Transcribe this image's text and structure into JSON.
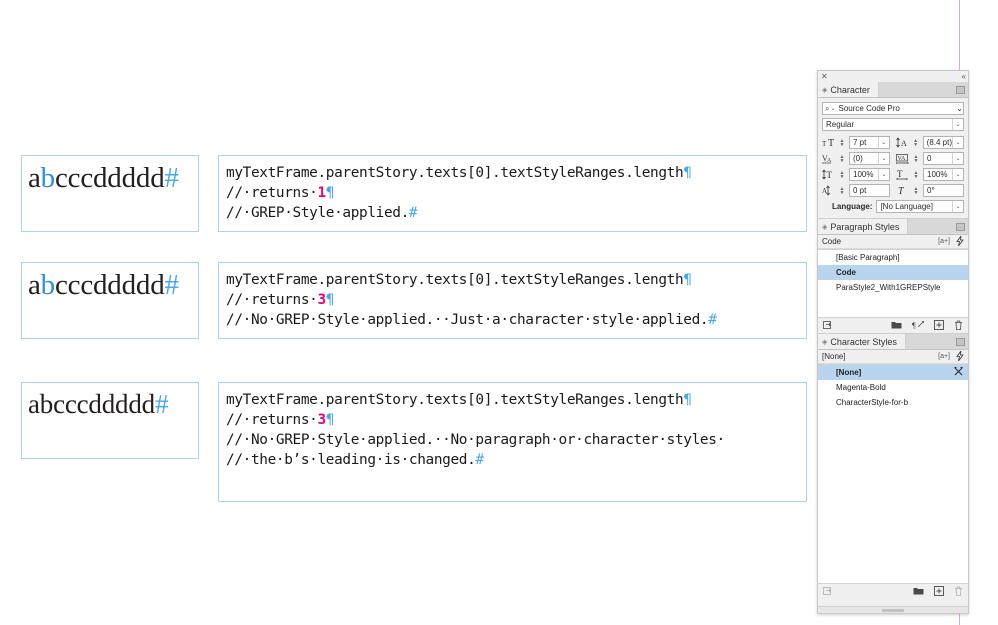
{
  "document": {
    "guide_color": "#d8a7e8",
    "frame_border_color": "#a9d4ef",
    "accent_magenta": "#e6007e",
    "accent_blue": "#4aa7e8"
  },
  "samples": [
    {
      "prefix": "a",
      "blue_char": "b",
      "suffix": "cccddddd",
      "hash": "#",
      "note": "blue-b-serif"
    },
    {
      "prefix": "a",
      "blue_char": "b",
      "suffix": "cccddddd",
      "hash": "#",
      "note": "blue-b-serif"
    },
    {
      "prefix": "abcccddddd",
      "blue_char": "",
      "suffix": "",
      "hash": "#",
      "note": "all-black-serif"
    }
  ],
  "code_blocks": [
    {
      "line1": "myTextFrame.parentStory.texts[0].textStyleRanges.length",
      "line1_pilcrow": "¶",
      "line2_pre": "//·returns·",
      "line2_num": "1",
      "line2_pilcrow": "¶",
      "line3": "//·GREP·Style·applied.",
      "line3_hash": "#",
      "line4": "",
      "line4_hash": ""
    },
    {
      "line1": "myTextFrame.parentStory.texts[0].textStyleRanges.length",
      "line1_pilcrow": "¶",
      "line2_pre": "//·returns·",
      "line2_num": "3",
      "line2_pilcrow": "¶",
      "line3": "//·No·GREP·Style·applied.··Just·a·character·style·applied.",
      "line3_hash": "#",
      "line4": "",
      "line4_hash": ""
    },
    {
      "line1": "myTextFrame.parentStory.texts[0].textStyleRanges.length",
      "line1_pilcrow": "¶",
      "line2_pre": "//·returns·",
      "line2_num": "3",
      "line2_pilcrow": "¶",
      "line3": "//·No·GREP·Style·applied.··No·paragraph·or·character·styles·",
      "line3_hash": "",
      "line4": "//·the·b’s·leading·is·changed.",
      "line4_hash": "#"
    }
  ],
  "panels": {
    "character": {
      "tab_label": "Character",
      "font_family": "Source Code Pro",
      "font_style": "Regular",
      "font_size": "7 pt",
      "leading": "(8.4 pt)",
      "kerning": "(0)",
      "tracking": "0",
      "vertical_scale": "100%",
      "horizontal_scale": "100%",
      "baseline_shift": "0 pt",
      "skew": "0°",
      "language_label": "Language:",
      "language_value": "[No Language]"
    },
    "paragraph_styles": {
      "tab_label": "Paragraph Styles",
      "current_style": "Code",
      "tag_label": "[a+]",
      "items": [
        {
          "label": "[Basic Paragraph]",
          "selected": false
        },
        {
          "label": "Code",
          "selected": true
        },
        {
          "label": "ParaStyle2_With1GREPStyle",
          "selected": false
        }
      ]
    },
    "character_styles": {
      "tab_label": "Character Styles",
      "current_style": "[None]",
      "tag_label": "[a+]",
      "items": [
        {
          "label": "[None]",
          "selected": true
        },
        {
          "label": "Magenta-Bold",
          "selected": false
        },
        {
          "label": "CharacterStyle-for-b",
          "selected": false
        }
      ]
    }
  },
  "icons": {
    "close": "✕",
    "collapse": "«",
    "panel_menu": "panel-menu-icon",
    "search": "⌕",
    "chevron_down": "∨",
    "bolt": "⚡",
    "folder": "folder-icon",
    "new_style": "⊞",
    "trash": "trash-icon",
    "clear_overrides": "¶",
    "break_link": "break-link-icon",
    "load_styles": "load-styles-icon"
  }
}
